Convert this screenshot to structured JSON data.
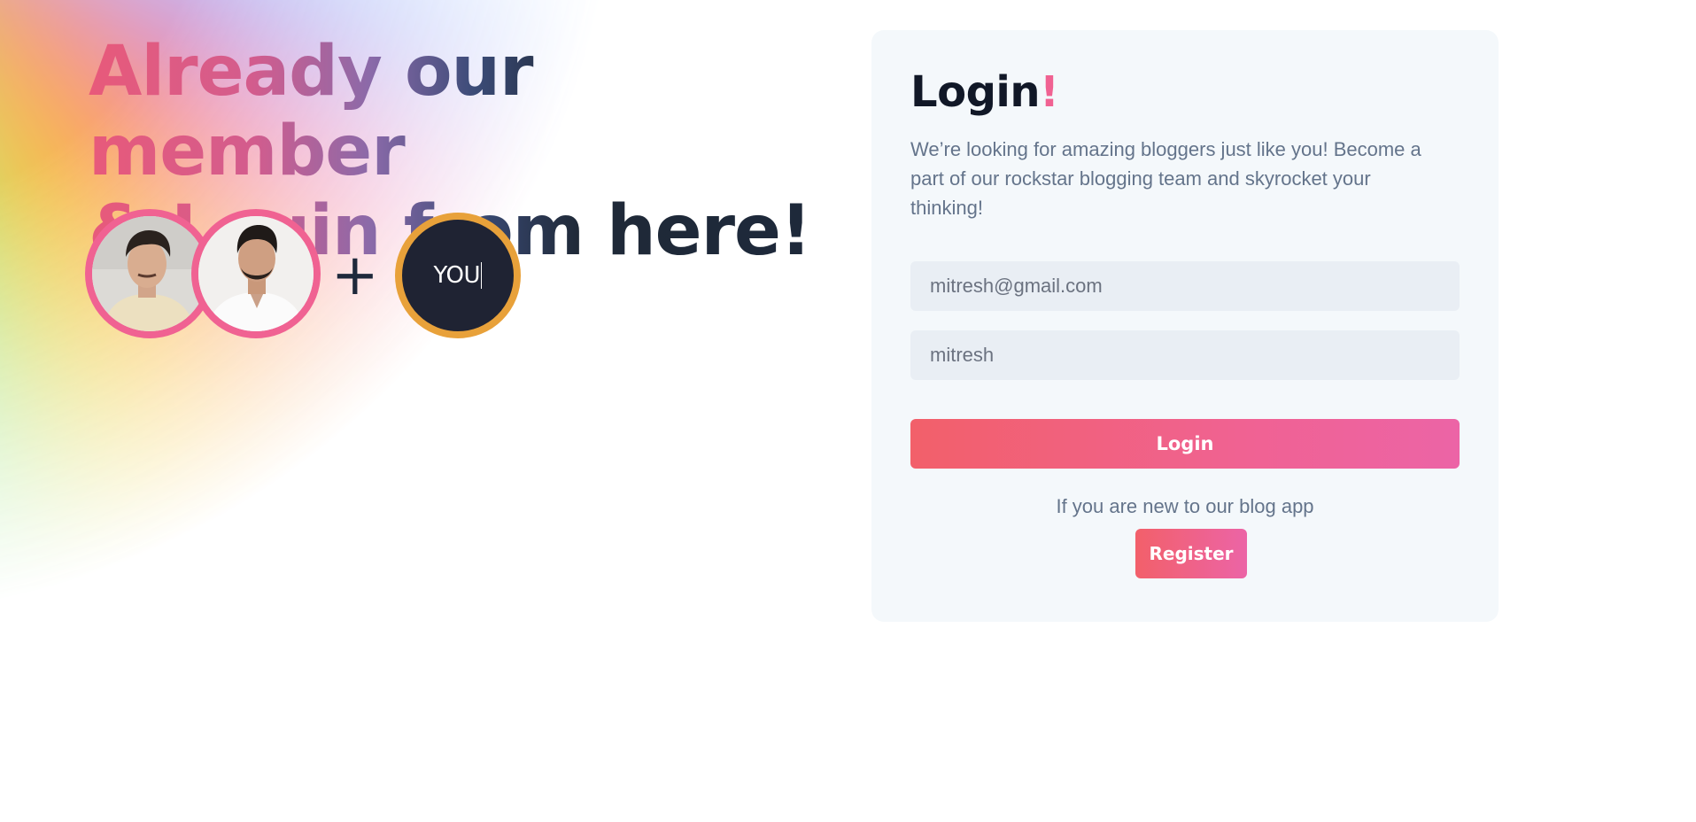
{
  "hero": {
    "title_line1": "Already our member",
    "title_line2": "& Login from here!",
    "plus_symbol": "+",
    "you_label": "YOU"
  },
  "avatars": [
    {
      "name": "member-avatar-1",
      "icon": "person-photo"
    },
    {
      "name": "member-avatar-2",
      "icon": "person-photo"
    }
  ],
  "login": {
    "title": "Login",
    "title_accent": "!",
    "description": "We’re looking for amazing bloggers just like you! Become a part of our rockstar blogging team and skyrocket your thinking!",
    "email_value": "mitresh@gmail.com",
    "password_value": "mitresh",
    "button_label": "Login",
    "new_user_text": "If you are new to our blog app",
    "register_label": "Register"
  },
  "colors": {
    "accent_pink": "#f06292",
    "accent_orange": "#e8a13a",
    "dark_navy": "#1e293b",
    "card_bg": "#f4f8fb",
    "input_bg": "#e9eef4"
  }
}
